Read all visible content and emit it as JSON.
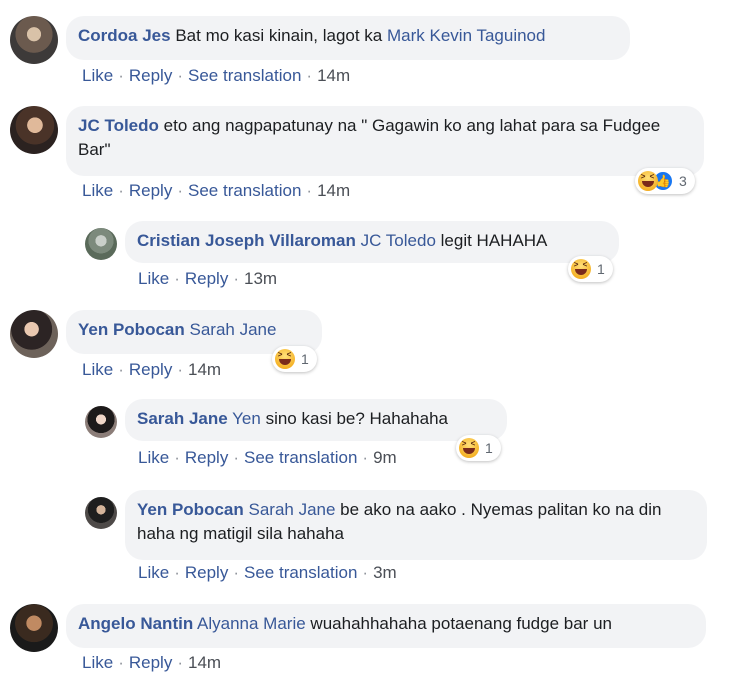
{
  "labels": {
    "like": "Like",
    "reply": "Reply",
    "see_translation": "See translation"
  },
  "comments": [
    {
      "author": "Cordoa Jes",
      "tag": "",
      "text": "Bat mo kasi kinain, lagot ka",
      "tag_after": "Mark Kevin Taguinod",
      "time": "14m",
      "reactions": null
    },
    {
      "author": "JC Toledo",
      "tag": "",
      "text": "eto ang nagpapatunay na \" Gagawin ko ang lahat para sa Fudgee Bar\"",
      "time": "14m",
      "reactions": {
        "count": "3",
        "icons": [
          "haha-icon",
          "like-icon"
        ]
      }
    },
    {
      "author": "Cristian Joseph Villaroman",
      "tag": "JC Toledo",
      "text": "legit HAHAHA",
      "time": "13m",
      "reactions": {
        "count": "1",
        "icons": [
          "haha-icon"
        ]
      }
    },
    {
      "author": "Yen Pobocan",
      "tag": "Sarah Jane",
      "text": "",
      "time": "14m",
      "reactions": {
        "count": "1",
        "icons": [
          "haha-icon"
        ]
      }
    },
    {
      "author": "Sarah Jane",
      "tag": "Yen",
      "text": "sino kasi be? Hahahaha",
      "time": "9m",
      "reactions": {
        "count": "1",
        "icons": [
          "haha-icon"
        ]
      }
    },
    {
      "author": "Yen Pobocan",
      "tag": "Sarah Jane",
      "text": "be ako na aako . Nyemas palitan ko na din haha ng matigil sila hahaha",
      "time": "3m",
      "reactions": null
    },
    {
      "author": "Angelo Nantin",
      "tag": "Alyanna Marie",
      "text": "wuahahhahaha potaenang fudge bar un",
      "time": "14m",
      "reactions": null
    }
  ],
  "colors": {
    "link": "#385898",
    "bubble": "#f2f3f5",
    "text": "#1c1e21",
    "like_blue": "#1877f2"
  }
}
